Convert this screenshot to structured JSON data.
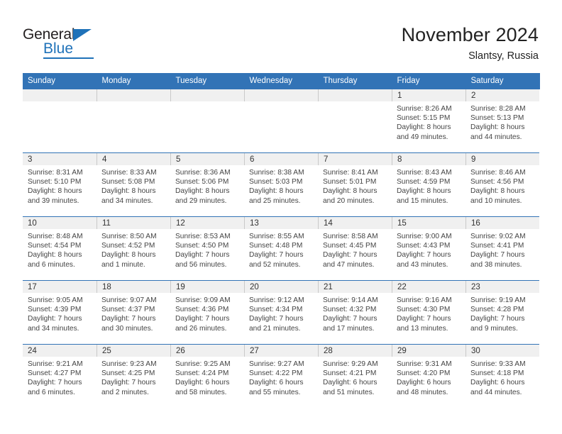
{
  "brand": {
    "name_part1": "General",
    "name_part2": "Blue",
    "logo_icon": "triangle-flag-icon",
    "accent_color": "#1f72b9"
  },
  "header": {
    "title": "November 2024",
    "subtitle": "Slantsy, Russia"
  },
  "theme": {
    "header_bg": "#3273b6",
    "header_text": "#ffffff",
    "daynum_strip_bg": "#f0f0f0",
    "cell_border": "#3273b6"
  },
  "weekday_headers": [
    "Sunday",
    "Monday",
    "Tuesday",
    "Wednesday",
    "Thursday",
    "Friday",
    "Saturday"
  ],
  "weeks": [
    [
      {
        "day": "",
        "empty": true,
        "sunrise": "",
        "sunset": "",
        "daylight_line1": "",
        "daylight_line2": ""
      },
      {
        "day": "",
        "empty": true,
        "sunrise": "",
        "sunset": "",
        "daylight_line1": "",
        "daylight_line2": ""
      },
      {
        "day": "",
        "empty": true,
        "sunrise": "",
        "sunset": "",
        "daylight_line1": "",
        "daylight_line2": ""
      },
      {
        "day": "",
        "empty": true,
        "sunrise": "",
        "sunset": "",
        "daylight_line1": "",
        "daylight_line2": ""
      },
      {
        "day": "",
        "empty": true,
        "sunrise": "",
        "sunset": "",
        "daylight_line1": "",
        "daylight_line2": ""
      },
      {
        "day": "1",
        "empty": false,
        "sunrise": "Sunrise: 8:26 AM",
        "sunset": "Sunset: 5:15 PM",
        "daylight_line1": "Daylight: 8 hours",
        "daylight_line2": "and 49 minutes."
      },
      {
        "day": "2",
        "empty": false,
        "sunrise": "Sunrise: 8:28 AM",
        "sunset": "Sunset: 5:13 PM",
        "daylight_line1": "Daylight: 8 hours",
        "daylight_line2": "and 44 minutes."
      }
    ],
    [
      {
        "day": "3",
        "empty": false,
        "sunrise": "Sunrise: 8:31 AM",
        "sunset": "Sunset: 5:10 PM",
        "daylight_line1": "Daylight: 8 hours",
        "daylight_line2": "and 39 minutes."
      },
      {
        "day": "4",
        "empty": false,
        "sunrise": "Sunrise: 8:33 AM",
        "sunset": "Sunset: 5:08 PM",
        "daylight_line1": "Daylight: 8 hours",
        "daylight_line2": "and 34 minutes."
      },
      {
        "day": "5",
        "empty": false,
        "sunrise": "Sunrise: 8:36 AM",
        "sunset": "Sunset: 5:06 PM",
        "daylight_line1": "Daylight: 8 hours",
        "daylight_line2": "and 29 minutes."
      },
      {
        "day": "6",
        "empty": false,
        "sunrise": "Sunrise: 8:38 AM",
        "sunset": "Sunset: 5:03 PM",
        "daylight_line1": "Daylight: 8 hours",
        "daylight_line2": "and 25 minutes."
      },
      {
        "day": "7",
        "empty": false,
        "sunrise": "Sunrise: 8:41 AM",
        "sunset": "Sunset: 5:01 PM",
        "daylight_line1": "Daylight: 8 hours",
        "daylight_line2": "and 20 minutes."
      },
      {
        "day": "8",
        "empty": false,
        "sunrise": "Sunrise: 8:43 AM",
        "sunset": "Sunset: 4:59 PM",
        "daylight_line1": "Daylight: 8 hours",
        "daylight_line2": "and 15 minutes."
      },
      {
        "day": "9",
        "empty": false,
        "sunrise": "Sunrise: 8:46 AM",
        "sunset": "Sunset: 4:56 PM",
        "daylight_line1": "Daylight: 8 hours",
        "daylight_line2": "and 10 minutes."
      }
    ],
    [
      {
        "day": "10",
        "empty": false,
        "sunrise": "Sunrise: 8:48 AM",
        "sunset": "Sunset: 4:54 PM",
        "daylight_line1": "Daylight: 8 hours",
        "daylight_line2": "and 6 minutes."
      },
      {
        "day": "11",
        "empty": false,
        "sunrise": "Sunrise: 8:50 AM",
        "sunset": "Sunset: 4:52 PM",
        "daylight_line1": "Daylight: 8 hours",
        "daylight_line2": "and 1 minute."
      },
      {
        "day": "12",
        "empty": false,
        "sunrise": "Sunrise: 8:53 AM",
        "sunset": "Sunset: 4:50 PM",
        "daylight_line1": "Daylight: 7 hours",
        "daylight_line2": "and 56 minutes."
      },
      {
        "day": "13",
        "empty": false,
        "sunrise": "Sunrise: 8:55 AM",
        "sunset": "Sunset: 4:48 PM",
        "daylight_line1": "Daylight: 7 hours",
        "daylight_line2": "and 52 minutes."
      },
      {
        "day": "14",
        "empty": false,
        "sunrise": "Sunrise: 8:58 AM",
        "sunset": "Sunset: 4:45 PM",
        "daylight_line1": "Daylight: 7 hours",
        "daylight_line2": "and 47 minutes."
      },
      {
        "day": "15",
        "empty": false,
        "sunrise": "Sunrise: 9:00 AM",
        "sunset": "Sunset: 4:43 PM",
        "daylight_line1": "Daylight: 7 hours",
        "daylight_line2": "and 43 minutes."
      },
      {
        "day": "16",
        "empty": false,
        "sunrise": "Sunrise: 9:02 AM",
        "sunset": "Sunset: 4:41 PM",
        "daylight_line1": "Daylight: 7 hours",
        "daylight_line2": "and 38 minutes."
      }
    ],
    [
      {
        "day": "17",
        "empty": false,
        "sunrise": "Sunrise: 9:05 AM",
        "sunset": "Sunset: 4:39 PM",
        "daylight_line1": "Daylight: 7 hours",
        "daylight_line2": "and 34 minutes."
      },
      {
        "day": "18",
        "empty": false,
        "sunrise": "Sunrise: 9:07 AM",
        "sunset": "Sunset: 4:37 PM",
        "daylight_line1": "Daylight: 7 hours",
        "daylight_line2": "and 30 minutes."
      },
      {
        "day": "19",
        "empty": false,
        "sunrise": "Sunrise: 9:09 AM",
        "sunset": "Sunset: 4:36 PM",
        "daylight_line1": "Daylight: 7 hours",
        "daylight_line2": "and 26 minutes."
      },
      {
        "day": "20",
        "empty": false,
        "sunrise": "Sunrise: 9:12 AM",
        "sunset": "Sunset: 4:34 PM",
        "daylight_line1": "Daylight: 7 hours",
        "daylight_line2": "and 21 minutes."
      },
      {
        "day": "21",
        "empty": false,
        "sunrise": "Sunrise: 9:14 AM",
        "sunset": "Sunset: 4:32 PM",
        "daylight_line1": "Daylight: 7 hours",
        "daylight_line2": "and 17 minutes."
      },
      {
        "day": "22",
        "empty": false,
        "sunrise": "Sunrise: 9:16 AM",
        "sunset": "Sunset: 4:30 PM",
        "daylight_line1": "Daylight: 7 hours",
        "daylight_line2": "and 13 minutes."
      },
      {
        "day": "23",
        "empty": false,
        "sunrise": "Sunrise: 9:19 AM",
        "sunset": "Sunset: 4:28 PM",
        "daylight_line1": "Daylight: 7 hours",
        "daylight_line2": "and 9 minutes."
      }
    ],
    [
      {
        "day": "24",
        "empty": false,
        "sunrise": "Sunrise: 9:21 AM",
        "sunset": "Sunset: 4:27 PM",
        "daylight_line1": "Daylight: 7 hours",
        "daylight_line2": "and 6 minutes."
      },
      {
        "day": "25",
        "empty": false,
        "sunrise": "Sunrise: 9:23 AM",
        "sunset": "Sunset: 4:25 PM",
        "daylight_line1": "Daylight: 7 hours",
        "daylight_line2": "and 2 minutes."
      },
      {
        "day": "26",
        "empty": false,
        "sunrise": "Sunrise: 9:25 AM",
        "sunset": "Sunset: 4:24 PM",
        "daylight_line1": "Daylight: 6 hours",
        "daylight_line2": "and 58 minutes."
      },
      {
        "day": "27",
        "empty": false,
        "sunrise": "Sunrise: 9:27 AM",
        "sunset": "Sunset: 4:22 PM",
        "daylight_line1": "Daylight: 6 hours",
        "daylight_line2": "and 55 minutes."
      },
      {
        "day": "28",
        "empty": false,
        "sunrise": "Sunrise: 9:29 AM",
        "sunset": "Sunset: 4:21 PM",
        "daylight_line1": "Daylight: 6 hours",
        "daylight_line2": "and 51 minutes."
      },
      {
        "day": "29",
        "empty": false,
        "sunrise": "Sunrise: 9:31 AM",
        "sunset": "Sunset: 4:20 PM",
        "daylight_line1": "Daylight: 6 hours",
        "daylight_line2": "and 48 minutes."
      },
      {
        "day": "30",
        "empty": false,
        "sunrise": "Sunrise: 9:33 AM",
        "sunset": "Sunset: 4:18 PM",
        "daylight_line1": "Daylight: 6 hours",
        "daylight_line2": "and 44 minutes."
      }
    ]
  ]
}
